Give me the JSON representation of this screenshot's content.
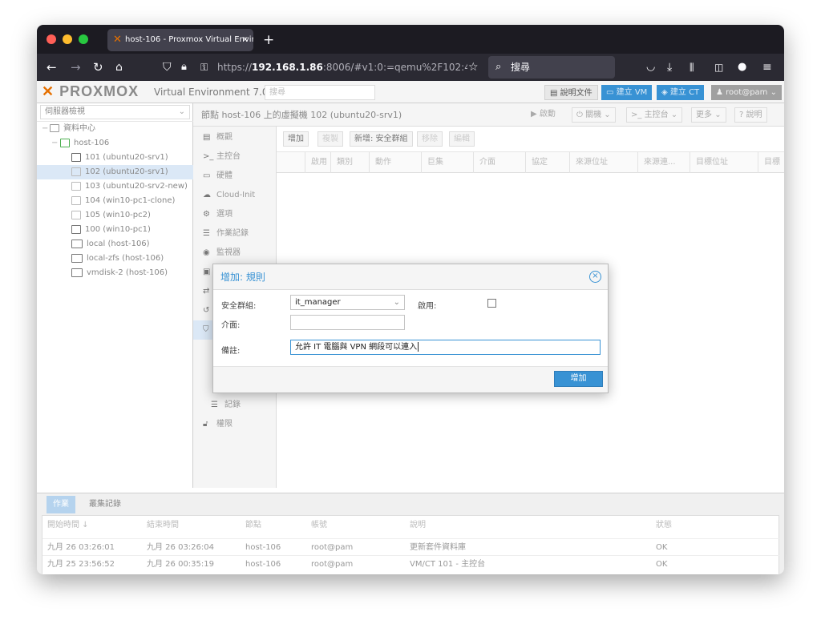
{
  "browser": {
    "tab_title": "host-106 - Proxmox Virtual Envir",
    "tab_close": "×",
    "new_tab": "+",
    "url_prefix": "https://",
    "url_host": "192.168.1.86",
    "url_rest": ":8006/#v1:0:=qemu%2F102:4:10:=con",
    "search_placeholder": "搜尋"
  },
  "pve_header": {
    "logo": "PROXMOX",
    "version": "Virtual Environment 7.0-11",
    "search_placeholder": "搜尋",
    "docs_label": "說明文件",
    "create_vm_label": "建立 VM",
    "create_ct_label": "建立 CT",
    "user_label": "root@pam"
  },
  "resource_tree": {
    "view_selector": "伺服器檢視",
    "items": [
      {
        "label": "資料中心"
      },
      {
        "label": "host-106"
      },
      {
        "label": "101 (ubuntu20-srv1)"
      },
      {
        "label": "102 (ubuntu20-srv1)"
      },
      {
        "label": "103 (ubuntu20-srv2-new)"
      },
      {
        "label": "104 (win10-pc1-clone)"
      },
      {
        "label": "105 (win10-pc2)"
      },
      {
        "label": "100 (win10-pc1)"
      },
      {
        "label": "local (host-106)"
      },
      {
        "label": "local-zfs (host-106)"
      },
      {
        "label": "vmdisk-2 (host-106)"
      }
    ]
  },
  "content_header": {
    "title": "節點 host-106 上的虛擬機 102 (ubuntu20-srv1)",
    "start": "啟動",
    "shutdown": "關機",
    "console": "主控台",
    "more": "更多",
    "help": "說明"
  },
  "vm_nav": {
    "items": [
      {
        "label": "概觀"
      },
      {
        "label": "主控台"
      },
      {
        "label": "硬體"
      },
      {
        "label": "Cloud-Init"
      },
      {
        "label": "選項"
      },
      {
        "label": "作業記錄"
      },
      {
        "label": "監視器"
      },
      {
        "label": "記錄"
      },
      {
        "label": "權限"
      }
    ]
  },
  "firewall": {
    "toolbar": {
      "add": "增加",
      "copy": "複製",
      "insert_group": "新增: 安全群組",
      "remove": "移除",
      "edit": "編輯"
    },
    "columns": [
      "啟用",
      "類別",
      "動作",
      "巨集",
      "介面",
      "協定",
      "來源位址",
      "來源連...",
      "目標位址",
      "目標"
    ]
  },
  "dialog": {
    "title": "增加: 規則",
    "security_group_label": "安全群組:",
    "security_group_value": "it_manager",
    "enable_label": "啟用:",
    "interface_label": "介面:",
    "interface_value": "",
    "comment_label": "備註:",
    "comment_value": "允許 IT 電腦與 VPN 網段可以連入",
    "submit": "增加"
  },
  "log_panel": {
    "tabs": [
      "作業",
      "叢集記錄"
    ],
    "columns": [
      "開始時間 ↓",
      "結束時間",
      "節點",
      "帳號",
      "說明",
      "狀態"
    ],
    "rows": [
      [
        "九月 26 03:26:01",
        "九月 26 03:26:04",
        "host-106",
        "root@pam",
        "更新套件資料庫",
        "OK"
      ],
      [
        "九月 25 23:56:52",
        "九月 26 00:35:19",
        "host-106",
        "root@pam",
        "VM/CT 101 - 主控台",
        "OK"
      ]
    ]
  }
}
